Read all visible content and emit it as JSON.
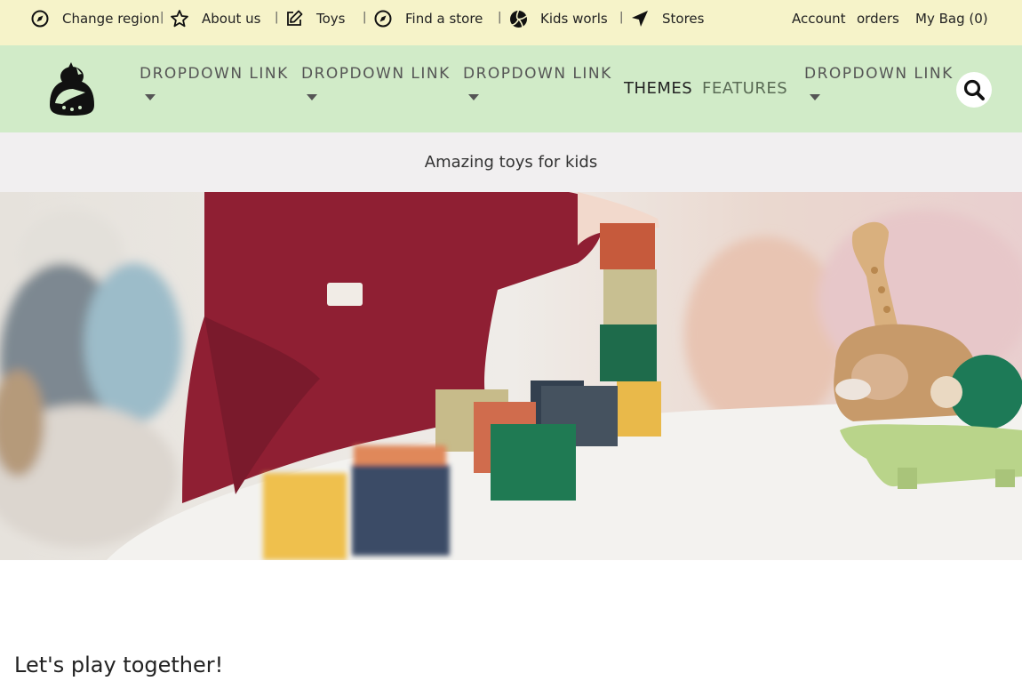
{
  "utility_bar": {
    "items": [
      {
        "label": "Change region",
        "icon": "compass-icon"
      },
      {
        "label": "About us",
        "icon": "star-icon"
      },
      {
        "label": "Toys",
        "icon": "edit-icon"
      },
      {
        "label": "Find a store",
        "icon": "compass-icon"
      },
      {
        "label": "Kids worls",
        "icon": "volleyball-icon"
      },
      {
        "label": "Stores",
        "icon": "location-arrow-icon"
      }
    ],
    "separator": "|",
    "account_label": "Account",
    "orders_label": "orders",
    "bag_label": "My Bag (0)"
  },
  "main_nav": {
    "logo_icon": "ninja-logo-icon",
    "dropdowns": [
      "DROPDOWN LINK",
      "DROPDOWN LINK",
      "DROPDOWN LINK",
      "DROPDOWN LINK"
    ],
    "themes_label": "THEMES",
    "features_label": "FEATURES",
    "search_icon": "search-icon"
  },
  "tagline": "Amazing toys for kids",
  "section": {
    "title": "Let's play together!"
  },
  "colors": {
    "utility_bg": "#f6f3c9",
    "nav_bg": "#d1ebc8",
    "tagline_bg": "#f1eff0"
  }
}
